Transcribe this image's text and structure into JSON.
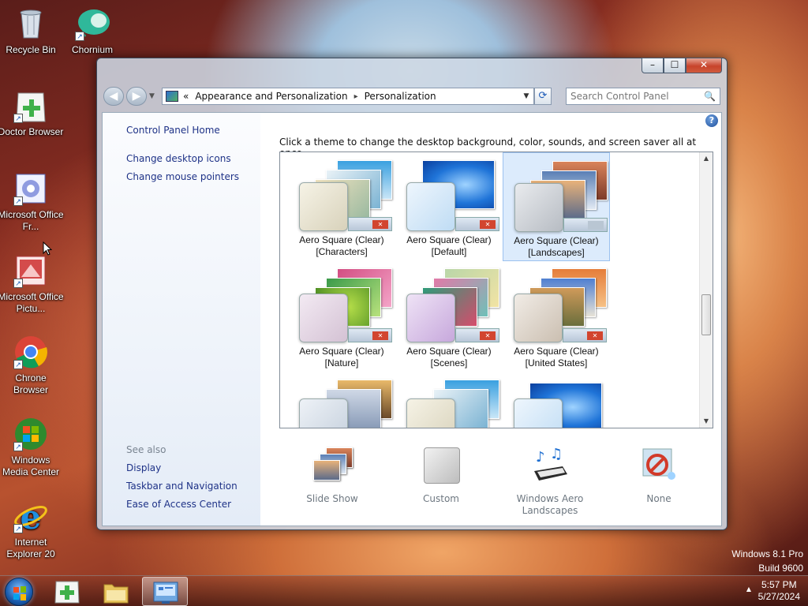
{
  "desktop": {
    "icons": [
      {
        "label": "Recycle Bin",
        "icon": "recycle-bin-icon"
      },
      {
        "label": "Chornium",
        "icon": "chornium-icon"
      },
      {
        "label": "Doctor Browser",
        "icon": "doctor-browser-icon"
      },
      {
        "label": "Microsoft Office Fr...",
        "icon": "office-icon"
      },
      {
        "label": "Microsoft Office Pictu...",
        "icon": "office-picture-icon"
      },
      {
        "label": "Chrone Browser",
        "icon": "chrome-icon"
      },
      {
        "label": "Windows Media Center",
        "icon": "media-center-icon"
      },
      {
        "label": "Internet Explorer 20",
        "icon": "ie-icon"
      }
    ],
    "watermark": {
      "line1": "Windows 8.1 Pro",
      "line2": "Build 9600"
    }
  },
  "window": {
    "controls": {
      "minimize": "–",
      "maximize": "☐",
      "close": "✕"
    },
    "nav": {
      "back": "◀",
      "forward": "▶",
      "recent": "▼"
    },
    "address": {
      "prefix": "«",
      "crumb1": "Appearance and Personalization",
      "sep": "▸",
      "crumb2": "Personalization",
      "dropdown": "▼",
      "refresh": "⟳"
    },
    "search": {
      "placeholder": "Search Control Panel",
      "icon": "🔍"
    },
    "help": "?",
    "left_pane": {
      "home": "Control Panel Home",
      "links": [
        "Change desktop icons",
        "Change mouse pointers"
      ],
      "see_also_title": "See also",
      "see_also": [
        "Display",
        "Taskbar and Navigation",
        "Ease of Access Center"
      ]
    },
    "intro": "Click a theme to change the desktop background, color, sounds, and screen saver all at once.",
    "themes": [
      {
        "line1": "Aero Square (Clear)",
        "line2": "[Characters]",
        "selected": false
      },
      {
        "line1": "Aero Square (Clear)",
        "line2": "[Default]",
        "selected": false
      },
      {
        "line1": "Aero Square (Clear)",
        "line2": "[Landscapes]",
        "selected": true
      },
      {
        "line1": "Aero Square (Clear)",
        "line2": "[Nature]",
        "selected": false
      },
      {
        "line1": "Aero Square (Clear)",
        "line2": "[Scenes]",
        "selected": false
      },
      {
        "line1": "Aero Square (Clear)",
        "line2": "[United States]",
        "selected": false
      }
    ],
    "bottom": [
      {
        "label": "Slide Show",
        "icon": "slideshow-icon"
      },
      {
        "label": "Custom",
        "icon": "custom-color-icon"
      },
      {
        "label": "Windows Aero Landscapes",
        "icon": "sounds-icon"
      },
      {
        "label": "None",
        "icon": "screensaver-icon"
      }
    ]
  },
  "taskbar": {
    "time": "5:57 PM",
    "date": "5/27/2024",
    "tray_arrow": "▲"
  }
}
